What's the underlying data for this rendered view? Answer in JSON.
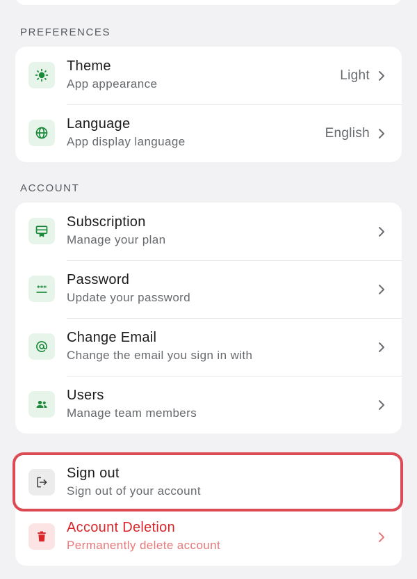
{
  "preferences": {
    "header": "PREFERENCES",
    "items": [
      {
        "title": "Theme",
        "subtitle": "App appearance",
        "value": "Light",
        "icon": "sun-icon"
      },
      {
        "title": "Language",
        "subtitle": "App display language",
        "value": "English",
        "icon": "globe-icon"
      }
    ]
  },
  "account": {
    "header": "ACCOUNT",
    "items": [
      {
        "title": "Subscription",
        "subtitle": "Manage your plan",
        "icon": "subscription-icon"
      },
      {
        "title": "Password",
        "subtitle": "Update your password",
        "icon": "password-icon"
      },
      {
        "title": "Change Email",
        "subtitle": "Change the email you sign in with",
        "icon": "at-sign-icon"
      },
      {
        "title": "Users",
        "subtitle": "Manage team members",
        "icon": "users-icon"
      }
    ]
  },
  "signout": {
    "title": "Sign out",
    "subtitle": "Sign out of your account",
    "icon": "sign-out-icon"
  },
  "deletion": {
    "title": "Account Deletion",
    "subtitle": "Permanently delete account",
    "icon": "trash-icon"
  },
  "colors": {
    "accent_green": "#1a8a3a",
    "danger_red": "#d8262a",
    "highlight_border": "#dc4b55"
  }
}
